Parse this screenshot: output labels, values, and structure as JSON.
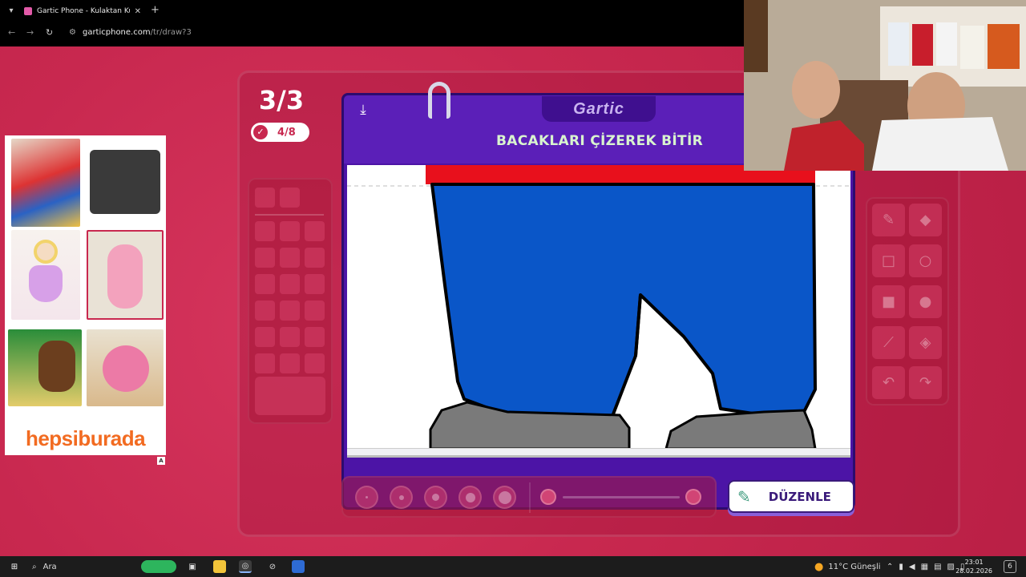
{
  "browser": {
    "tab_title": "Gartic Phone - Kulaktan Kulağa",
    "url_host": "garticphone.com",
    "url_path": "/tr/draw?3"
  },
  "ad": {
    "brand": "hepsiburada",
    "badge": "A"
  },
  "game": {
    "round": "3/3",
    "done_count": "4/8",
    "logo": "Gartic",
    "prompt": "BACAKLARI ÇİZEREK BİTİR",
    "edit_button": "DÜZENLE"
  },
  "taskbar": {
    "search": "Ara",
    "weather": "11°C  Güneşli",
    "time": "23:01",
    "date": "28.02.2026",
    "notifications": "6"
  },
  "colors": {
    "background": "#c8284f",
    "card": "#4c14a6",
    "prompt_text": "#d9f4cf",
    "drawing_red": "#e8101c",
    "drawing_blue": "#0a56c8",
    "drawing_gray": "#7a7a7a"
  }
}
